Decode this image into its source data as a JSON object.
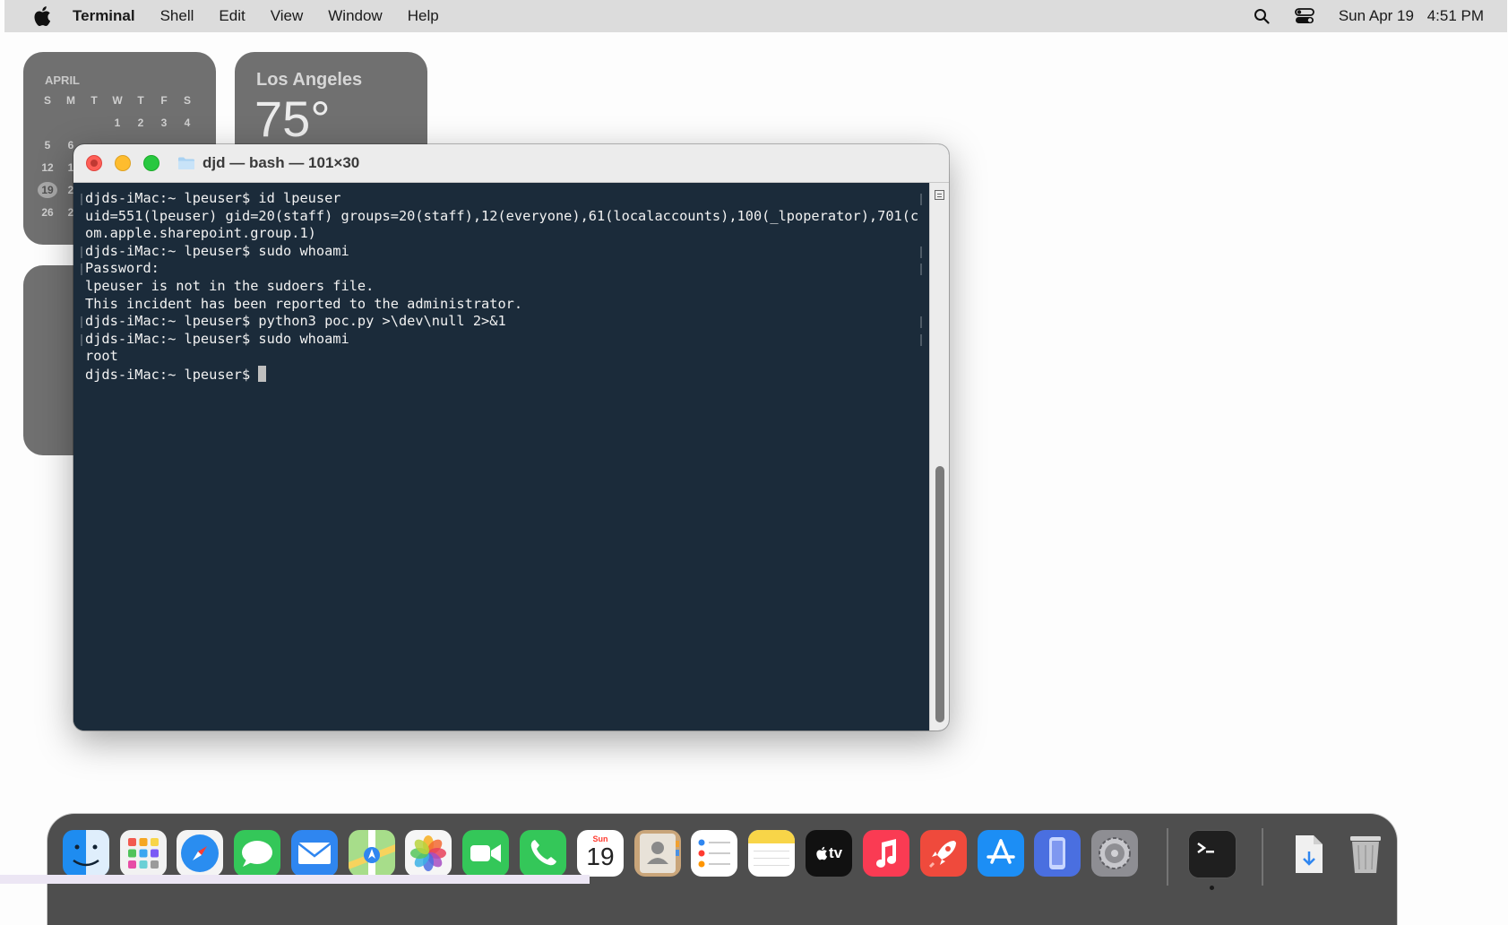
{
  "menubar": {
    "app_name": "Terminal",
    "items": [
      "Shell",
      "Edit",
      "View",
      "Window",
      "Help"
    ],
    "date": "Sun Apr 19",
    "time": "4:51 PM"
  },
  "calendar_widget": {
    "month": "APRIL",
    "weekdays": [
      "S",
      "M",
      "T",
      "W",
      "T",
      "F",
      "S"
    ],
    "row1": [
      "",
      "",
      "",
      "1",
      "2",
      "3",
      "4"
    ],
    "row2": [
      "5",
      "6"
    ],
    "row3": [
      "12",
      "1"
    ],
    "row4": [
      "19",
      "2"
    ],
    "row5": [
      "26",
      "2"
    ]
  },
  "weather_widget": {
    "city": "Los Angeles",
    "temperature": "75°"
  },
  "terminal": {
    "title": "djd — bash — 101×30",
    "lines": [
      "djds-iMac:~ lpeuser$ id lpeuser",
      "uid=551(lpeuser) gid=20(staff) groups=20(staff),12(everyone),61(localaccounts),100(_lpoperator),701(c",
      "om.apple.sharepoint.group.1)",
      "djds-iMac:~ lpeuser$ sudo whoami",
      "Password:",
      "lpeuser is not in the sudoers file.",
      "This incident has been reported to the administrator.",
      "djds-iMac:~ lpeuser$ python3 poc.py >\\dev\\null 2>&1",
      "djds-iMac:~ lpeuser$ sudo whoami",
      "root"
    ],
    "prompt": "djds-iMac:~ lpeuser$ "
  },
  "dock": {
    "calendar_icon": {
      "month_abbr": "Sun",
      "day": "19"
    },
    "tv_label": "tv",
    "items": [
      "finder",
      "launchpad",
      "safari",
      "messages",
      "mail",
      "maps",
      "photos",
      "facetime",
      "phone",
      "calendar",
      "contacts",
      "reminders",
      "notes",
      "apple-tv",
      "music",
      "rocket",
      "app-store",
      "iphone-mirroring",
      "system-settings",
      "terminal",
      "downloads",
      "trash"
    ]
  },
  "colors": {
    "terminal_bg": "#1b2b3a",
    "menubar_bg": "#dcdcdc",
    "dock_bg": "#4e4e4e",
    "close": "#fe5f57",
    "minimize": "#febc2e",
    "zoom": "#28c840"
  }
}
